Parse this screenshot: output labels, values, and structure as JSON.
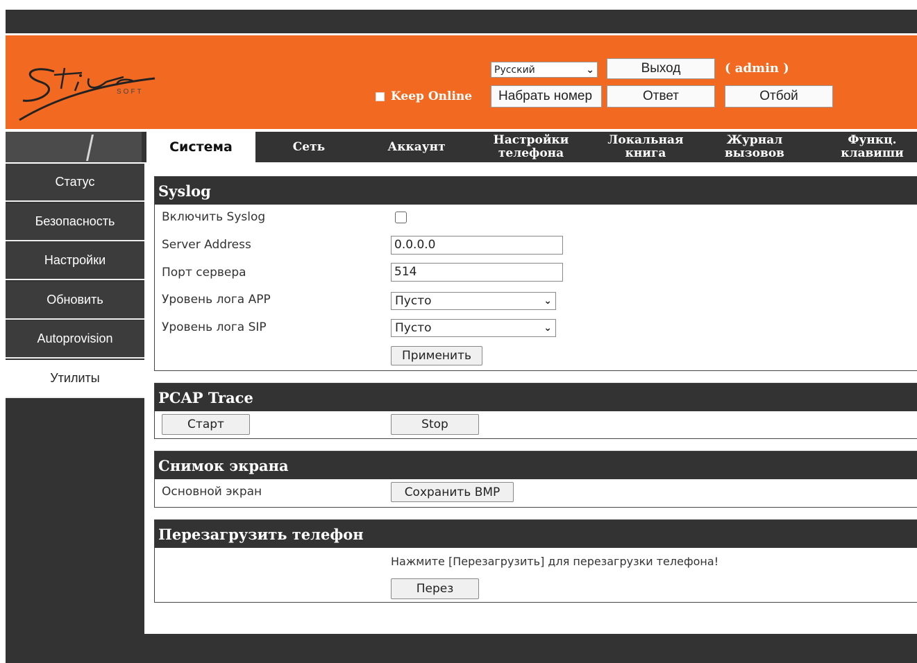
{
  "header": {
    "keep_online": "Keep Online",
    "language": "Русский",
    "dial_input": "Набрать номер",
    "logout": "Выход",
    "user": "( admin )",
    "answer": "Ответ",
    "hangup": "Отбой"
  },
  "tabs": [
    {
      "label": "Система",
      "active": true
    },
    {
      "label": "Сеть"
    },
    {
      "label": "Аккаунт"
    },
    {
      "label": "Настройки телефона"
    },
    {
      "label": "Локальная книга"
    },
    {
      "label": "Журнал вызовов"
    },
    {
      "label": "Функц. клавиши"
    }
  ],
  "sidebar": {
    "items": [
      {
        "label": "Статус"
      },
      {
        "label": "Безопасность"
      },
      {
        "label": "Настройки"
      },
      {
        "label": "Обновить"
      },
      {
        "label": "Autoprovision"
      },
      {
        "label": "Утилиты",
        "active": true
      }
    ]
  },
  "syslog": {
    "title": "Syslog",
    "enable_label": "Включить Syslog",
    "enable_checked": false,
    "server_label": "Server Address",
    "server_value": "0.0.0.0",
    "port_label": "Порт сервера",
    "port_value": "514",
    "app_level_label": "Уровень лога APP",
    "app_level_value": "Пусто",
    "sip_level_label": "Уровень лога SIP",
    "sip_level_value": "Пусто",
    "apply": "Применить"
  },
  "pcap": {
    "title": "PCAP Trace",
    "start": "Старт",
    "stop": "Stop"
  },
  "screenshot": {
    "title": "Снимок экрана",
    "main_label": "Основной экран",
    "save": "Сохранить BMP"
  },
  "reboot": {
    "title": "Перезагрузить телефон",
    "message": "Нажмите [Перезагрузить] для перезагрузки телефона!",
    "button": "Перез"
  },
  "colors": {
    "header_orange": "#f26a22",
    "dark_bar": "#333333"
  }
}
